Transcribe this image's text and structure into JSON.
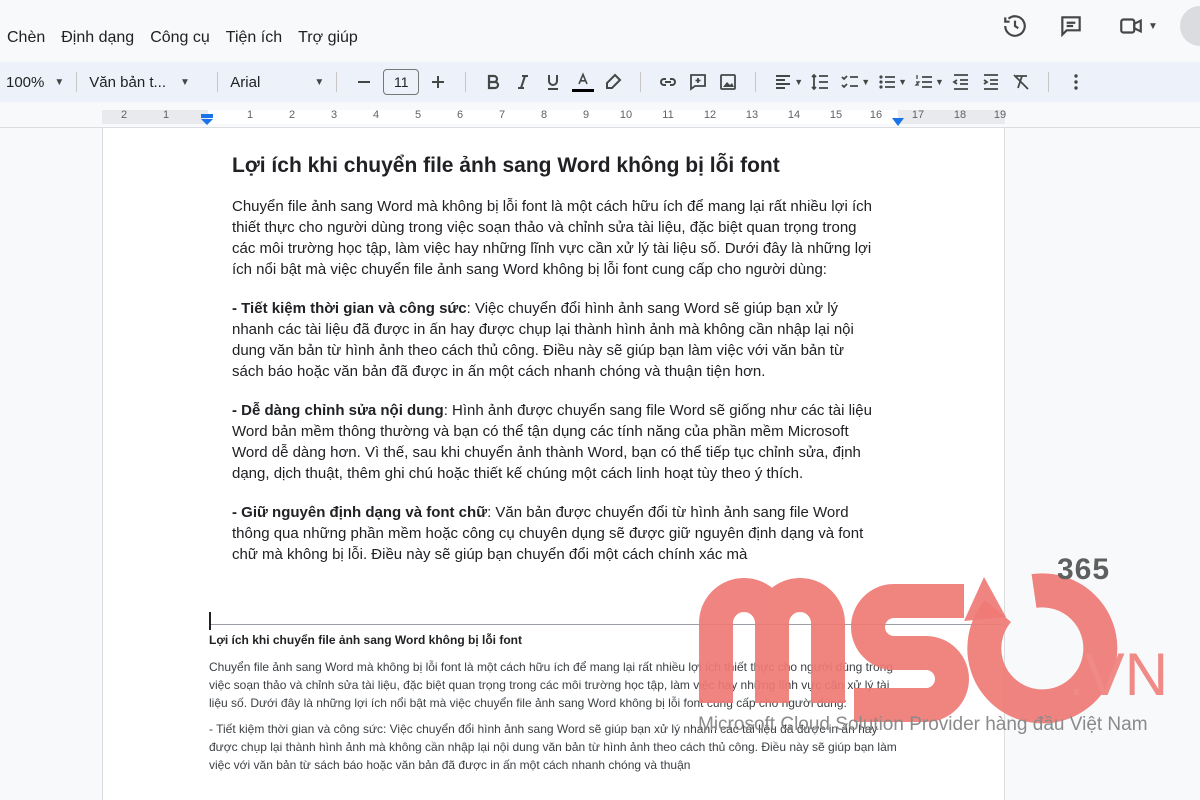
{
  "menu": {
    "items": [
      "Chèn",
      "Định dạng",
      "Công cụ",
      "Tiện ích",
      "Trợ giúp"
    ]
  },
  "toolbar": {
    "zoom": "100%",
    "style": "Văn bản t...",
    "font": "Arial",
    "font_size": "11"
  },
  "ruler": {
    "numbers_left": [
      "2",
      "1"
    ],
    "numbers": [
      "1",
      "2",
      "3",
      "4",
      "5",
      "6",
      "7",
      "8",
      "9",
      "10",
      "11",
      "12",
      "13",
      "14",
      "15",
      "16",
      "17",
      "18",
      "19"
    ]
  },
  "document": {
    "heading": "Lợi ích khi chuyển file ảnh sang Word không bị lỗi font",
    "intro": "Chuyển file ảnh sang Word mà không bị lỗi font là một cách hữu ích để mang lại rất nhiều lợi ích thiết thực cho người dùng trong việc soạn thảo và chỉnh sửa tài liệu, đặc biệt quan trọng trong các môi trường học tập, làm việc hay những lĩnh vực cần xử lý tài liệu số. Dưới đây là những lợi ích nổi bật mà việc chuyển file ảnh sang Word không bị lỗi font cung cấp cho người dùng:",
    "point1_title": "- Tiết kiệm thời gian và công sức",
    "point1_text": ": Việc chuyển đổi hình ảnh sang Word sẽ giúp bạn xử lý nhanh các tài liệu đã được in ấn hay được chụp lại thành hình ảnh mà không cần nhập lại nội dung văn bản từ hình ảnh theo cách thủ công. Điều này sẽ giúp bạn làm việc với văn bản từ sách báo hoặc văn bản đã được in ấn một cách nhanh chóng và thuận tiện hơn.",
    "point2_title": "- Dễ dàng chỉnh sửa nội dung",
    "point2_text": ": Hình ảnh được chuyển sang file Word sẽ giống như các tài liệu Word bản mềm thông thường và bạn có thể tận dụng các tính năng của phần mềm Microsoft Word dễ dàng hơn. Vì thế, sau khi chuyển ảnh thành Word, bạn có thể tiếp tục chỉnh sửa, định dạng, dịch thuật, thêm ghi chú hoặc thiết kế chúng một cách linh hoạt tùy theo ý thích.",
    "point3_title": "- Giữ nguyên định dạng và font chữ",
    "point3_text": ": Văn bản được chuyển đổi từ hình ảnh sang file Word thông qua những phần mềm hoặc công cụ chuyên dụng sẽ được giữ nguyên định dạng và font chữ mà không bị lỗi. Điều này sẽ giúp bạn chuyển đổi một cách chính xác mà"
  },
  "pasted": {
    "heading": "Lợi ích khi chuyển file ảnh sang Word không bị lỗi font",
    "intro": "Chuyển file ảnh sang Word mà không bị lỗi font là một cách hữu ích để mang lại rất nhiều lợi ích thiết thực cho người dùng trong việc soạn thảo và chỉnh sửa tài liệu, đặc biệt quan trọng trong các môi trường học tập, làm việc hay những lĩnh vực cần xử lý tài liệu số. Dưới đây là những lợi ích nổi bật mà việc chuyển file ảnh sang Word không bị lỗi font cung cấp cho người dùng:",
    "point1": "- Tiết kiệm thời gian và công sức: Việc chuyển đổi hình ảnh sang Word sẽ giúp bạn xử lý nhanh các tài liệu đã được in ấn hay được chụp lại thành hình ảnh mà không cần nhập lại nội dung văn bản từ hình ảnh theo cách thủ công. Điều này sẽ giúp bạn làm việc với văn bản từ sách báo hoặc văn bản đã được in ấn một cách nhanh chóng và thuận"
  },
  "watermark": {
    "brand_number": "365",
    "brand_suffix": ".VN",
    "tagline": "Microsoft Cloud Solution Provider hàng đầu Việt Nam",
    "color": "#ef7a75"
  }
}
